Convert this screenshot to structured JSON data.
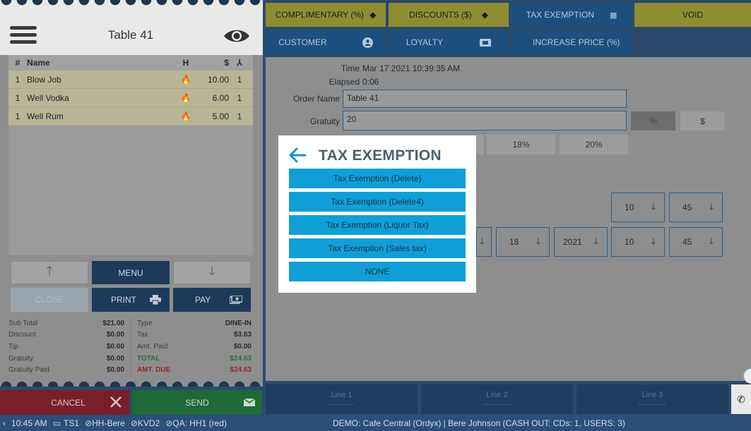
{
  "ticket": {
    "title": "Table 41",
    "columns": {
      "num": "#",
      "name": "Name",
      "h": "H",
      "price": "$",
      "qty_icon": "seat-icon"
    },
    "items": [
      {
        "qty": "1",
        "name": "Blow Job",
        "price": "10.00",
        "seat": "1"
      },
      {
        "qty": "1",
        "name": "Well Vodka",
        "price": "6.00",
        "seat": "1"
      },
      {
        "qty": "1",
        "name": "Well Rum",
        "price": "5.00",
        "seat": "1"
      }
    ],
    "buttons": {
      "menu": "MENU",
      "close": "CLOSE",
      "print": "PRINT",
      "pay": "PAY"
    },
    "totals_left": [
      {
        "label": "Sub Total",
        "value": "$21.00"
      },
      {
        "label": "Discount",
        "value": "$0.00"
      },
      {
        "label": "Tip",
        "value": "$0.00"
      },
      {
        "label": "Gratuity",
        "value": "$0.00"
      },
      {
        "label": "Gratuity Paid",
        "value": "$0.00"
      }
    ],
    "totals_right": [
      {
        "label": "Type",
        "value": "DINE-IN"
      },
      {
        "label": "Tax",
        "value": "$3.63"
      },
      {
        "label": "Amt. Paid",
        "value": "$0.00"
      },
      {
        "label": "TOTAL",
        "value": "$24.63"
      },
      {
        "label": "AMT. DUE",
        "value": "$24.63"
      }
    ],
    "cancel": "CANCEL",
    "send": "SEND"
  },
  "toolbar": {
    "complimentary": "COMPLIMENTARY (%)",
    "discounts": "DISCOUNTS ($)",
    "tax_exemption": "TAX EXEMPTION",
    "void": "VOID",
    "customer": "CUSTOMER",
    "loyalty": "LOYALTY",
    "increase_price": "INCREASE PRICE (%)"
  },
  "details": {
    "time_label": "Time",
    "time_value": "Mar 17 2021 10:39:35 AM",
    "elapsed_label": "Elapsed",
    "elapsed_value": "0:06",
    "order_name_label": "Order Name",
    "order_name_value": "Table 41",
    "gratuity_label": "Gratuity",
    "gratuity_value": "20",
    "pct_toggle": "%",
    "dollar_toggle": "$",
    "preset_18": "18%",
    "preset_20": "20%",
    "row1": {
      "hour": "10",
      "minute": "45"
    },
    "row2": {
      "day": "18",
      "year": "2021",
      "hour": "10",
      "minute": "45"
    }
  },
  "lines": [
    "Line 1",
    "Line 2",
    "Line 3"
  ],
  "lines_placeholder": "----------",
  "status": {
    "time": "10:45 AM",
    "terminal": "TS1",
    "printer1": "HH-Bere",
    "printer2": "KVD2",
    "printer3": "QA: HH1 (red)",
    "info": "DEMO: Cafe Central (Ordyx) | Bere Johnson (CASH OUT: CDs: 1, USERS: 3)"
  },
  "modal": {
    "title": "TAX EXEMPTION",
    "options": [
      "Tax Exemption (Delete)",
      "Tax Exemption (Delete4)",
      "Tax Exemption (Liquor Tax)",
      "Tax Exemption (Sales tax)",
      "NONE"
    ]
  },
  "colors": {
    "accent_blue": "#0f9fd6",
    "yellow_button": "#8f8d32",
    "cancel_red": "#7b1e2c",
    "send_green": "#1f6a38"
  }
}
